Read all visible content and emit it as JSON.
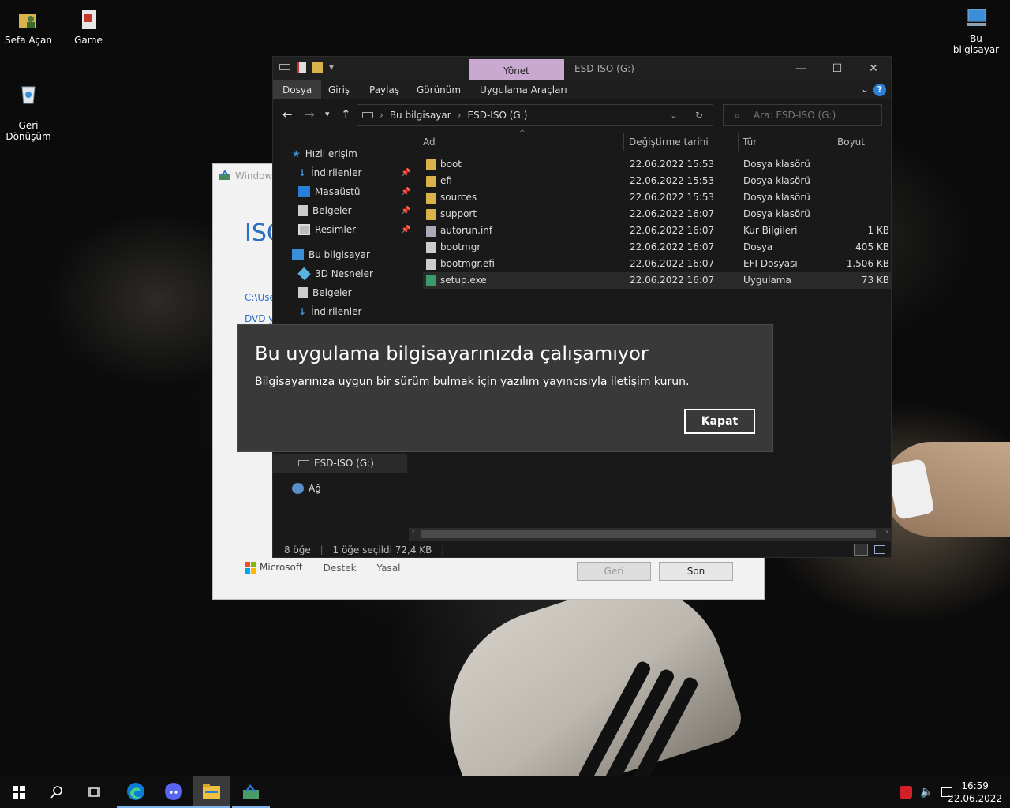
{
  "desktop": {
    "icons": [
      {
        "label": "Sefa Açan"
      },
      {
        "label": "Game"
      },
      {
        "label": "Geri\nDönüşüm"
      },
      {
        "label": "Bu bilgisayar"
      }
    ]
  },
  "back_window": {
    "title": "Windows",
    "heading": "ISO",
    "line1": "C:\\Use",
    "line2": "DVD ya",
    "footer_brand": "Microsoft",
    "footer_support": "Destek",
    "footer_legal": "Yasal",
    "back_button": "Geri",
    "next_button": "Son"
  },
  "explorer": {
    "manage_tab": "Yönet",
    "window_path": "ESD-ISO (G:)",
    "ribbon_tabs": [
      "Dosya",
      "Giriş",
      "Paylaş",
      "Görünüm",
      "Uygulama Araçları"
    ],
    "breadcrumb": [
      "Bu bilgisayar",
      "ESD-ISO (G:)"
    ],
    "search_placeholder": "Ara: ESD-ISO (G:)",
    "nav": {
      "quick_access": "Hızlı erişim",
      "quick_items": [
        "İndirilenler",
        "Masaüstü",
        "Belgeler",
        "Resimler"
      ],
      "this_pc": "Bu bilgisayar",
      "pc_items": [
        "3D Nesneler",
        "Belgeler",
        "İndirilenler"
      ],
      "drive": "ESD-ISO (G:)",
      "network": "Ağ"
    },
    "columns": {
      "name": "Ad",
      "modified": "Değiştirme tarihi",
      "type": "Tür",
      "size": "Boyut"
    },
    "files": [
      {
        "name": "boot",
        "modified": "22.06.2022 15:53",
        "type": "Dosya klasörü",
        "size": "",
        "kind": "folder"
      },
      {
        "name": "efi",
        "modified": "22.06.2022 15:53",
        "type": "Dosya klasörü",
        "size": "",
        "kind": "folder"
      },
      {
        "name": "sources",
        "modified": "22.06.2022 15:53",
        "type": "Dosya klasörü",
        "size": "",
        "kind": "folder"
      },
      {
        "name": "support",
        "modified": "22.06.2022 16:07",
        "type": "Dosya klasörü",
        "size": "",
        "kind": "folder"
      },
      {
        "name": "autorun.inf",
        "modified": "22.06.2022 16:07",
        "type": "Kur Bilgileri",
        "size": "1 KB",
        "kind": "ini"
      },
      {
        "name": "bootmgr",
        "modified": "22.06.2022 16:07",
        "type": "Dosya",
        "size": "405 KB",
        "kind": "file"
      },
      {
        "name": "bootmgr.efi",
        "modified": "22.06.2022 16:07",
        "type": "EFI Dosyası",
        "size": "1.506 KB",
        "kind": "file"
      },
      {
        "name": "setup.exe",
        "modified": "22.06.2022 16:07",
        "type": "Uygulama",
        "size": "73 KB",
        "kind": "exe"
      }
    ],
    "status": {
      "count": "8 öğe",
      "selected": "1 öğe seçildi  72,4 KB"
    }
  },
  "dialog": {
    "title": "Bu uygulama bilgisayarınızda çalışamıyor",
    "message": "Bilgisayarınıza uygun bir sürüm bulmak için yazılım yayıncısıyla iletişim kurun.",
    "close_button": "Kapat"
  },
  "taskbar": {
    "time": "16:59",
    "date": "22.06.2022"
  },
  "colors": {
    "accent": "#2a7fd8",
    "manage_tab": "#c9a9cf",
    "folder": "#d9b24a"
  }
}
